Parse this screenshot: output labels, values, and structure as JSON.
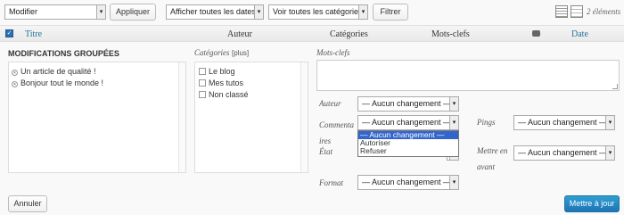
{
  "toolbar": {
    "bulk_action": "Modifier",
    "apply": "Appliquer",
    "dates_filter": "Afficher toutes les dates",
    "categories_filter": "Voir toutes les catégories",
    "filter": "Filtrer",
    "count": "2 éléments",
    "view_icons": [
      "list-view-icon",
      "excerpt-view-icon"
    ]
  },
  "table_header": {
    "title": "Titre",
    "author": "Auteur",
    "categories": "Catégories",
    "tags": "Mots-clefs",
    "comments_icon": "comment-bubble-icon",
    "date": "Date"
  },
  "bulk_edit": {
    "heading": "MODIFICATIONS GROUPÉES",
    "posts": [
      "Un article de qualité !",
      "Bonjour tout le monde !"
    ],
    "categories_label": "Catégories",
    "categories_more": "[plus]",
    "categories": [
      "Le blog",
      "Mes tutos",
      "Non classé"
    ],
    "tags_label": "Mots-clefs",
    "author_label": "Auteur",
    "author_value": "— Aucun changement —",
    "comments_label_1": "Commenta",
    "comments_label_2": "ires",
    "comments_value": "— Aucun changement —",
    "pings_label": "Pings",
    "pings_value": "— Aucun changement —",
    "status_label": "État",
    "sticky_label_1": "Mettre en",
    "sticky_label_2": "avant",
    "sticky_value": "— Aucun changement —",
    "format_label": "Format",
    "format_value": "— Aucun changement —",
    "dropdown_options": [
      "— Aucun changement —",
      "Autoriser",
      "Refuser"
    ],
    "cancel": "Annuler",
    "update": "Mettre à jour"
  },
  "colors": {
    "link": "#21759b",
    "primary": "#1e74b8",
    "selected": "#3366cc"
  }
}
